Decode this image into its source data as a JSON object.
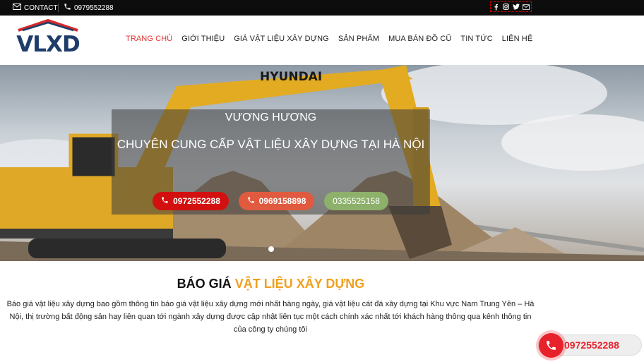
{
  "topbar": {
    "contact_label": "CONTACT",
    "phone": "0979552288",
    "social_icons": [
      "facebook-icon",
      "instagram-icon",
      "twitter-icon",
      "mail-icon"
    ]
  },
  "logo": {
    "text": "VLXD",
    "color": "#1e3d6b",
    "roof_color": "#d42a2a"
  },
  "nav": {
    "items": [
      {
        "label": "TRANG CHỦ",
        "active": true
      },
      {
        "label": "GIỚI THIỆU",
        "active": false
      },
      {
        "label": "GIÁ VẬT LIỆU XÂY DỰNG",
        "active": false
      },
      {
        "label": "SẢN PHẨM",
        "active": false
      },
      {
        "label": "MUA BÁN ĐỒ CŨ",
        "active": false
      },
      {
        "label": "TIN TỨC",
        "active": false
      },
      {
        "label": "LIÊN HỆ",
        "active": false
      }
    ],
    "active_color": "#e2332e"
  },
  "hero": {
    "title": "VƯƠNG HƯƠNG",
    "subtitle": "CHUYÊN CUNG CẤP VẬT LIỆU XÂY DỰNG  TẠI HÀ NỘI",
    "buttons": [
      {
        "label": "0972552288",
        "color": "#d31010"
      },
      {
        "label": "0969158898",
        "color": "#e05a3f"
      },
      {
        "label": "0335525158",
        "color": "#8db06a"
      }
    ],
    "excavator_brand": "HYUNDAI"
  },
  "section": {
    "title_part1": "BÁO GIÁ ",
    "title_part2": "VẬT LIỆU XÂY DỰNG",
    "accent_color": "#f0a01e",
    "text": "Báo giá vật liệu xây dựng bao gồm thông tin báo giá vật liệu xây dựng mới nhất hàng ngày, giá vật liệu cát đá xây dựng tại Khu vực Nam Trung Yên – Hà Nội, thị trường bất động sản hay liên quan tới ngành xây dựng được cập nhật liên tục một cách chính xác nhất tới khách hàng thông qua kênh thông tin của công ty chúng tôi"
  },
  "float_call": {
    "phone": "0972552288",
    "color": "#e8222a"
  }
}
